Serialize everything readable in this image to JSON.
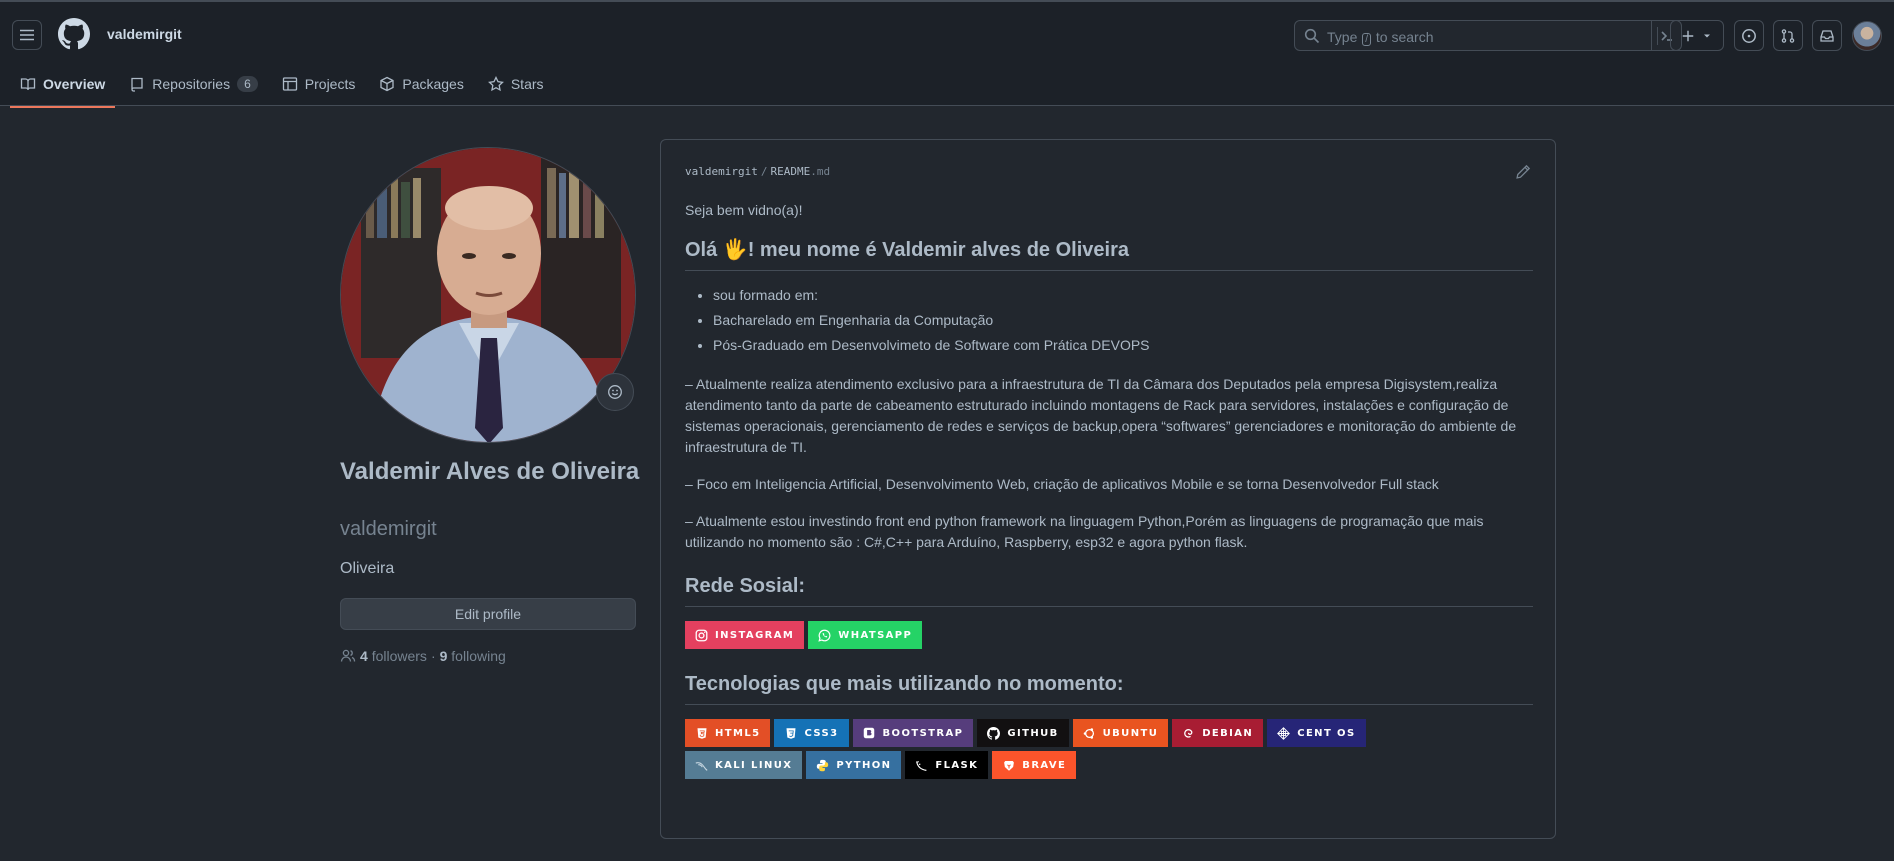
{
  "header": {
    "username": "valdemirgit",
    "search": {
      "placeholder_before": "Type",
      "placeholder_key": "/",
      "placeholder_after": "to search"
    }
  },
  "tabs": [
    {
      "label": "Overview",
      "icon": "book-icon",
      "active": true
    },
    {
      "label": "Repositories",
      "icon": "repo-icon",
      "count": "6"
    },
    {
      "label": "Projects",
      "icon": "table-icon"
    },
    {
      "label": "Packages",
      "icon": "package-icon"
    },
    {
      "label": "Stars",
      "icon": "star-icon"
    }
  ],
  "profile": {
    "name": "Valdemir Alves de Oliveira",
    "login": "valdemirgit",
    "bio": "Oliveira",
    "edit_label": "Edit profile",
    "followers_count": "4",
    "followers_label": "followers",
    "separator": "·",
    "following_count": "9",
    "following_label": "following"
  },
  "readme": {
    "crumb_owner": "valdemirgit",
    "crumb_sep": "/",
    "crumb_file": "README",
    "crumb_ext": ".md",
    "welcome": "Seja bem vidno(a)!",
    "heading1": "Olá 🖐! meu nome é Valdemir alves de Oliveira",
    "list": [
      "sou formado em:",
      "Bacharelado em Engenharia da Computação",
      "Pós-Graduado em Desenvolvimeto de Software com Prática DEVOPS"
    ],
    "para1": "– Atualmente realiza atendimento exclusivo para a infraestrutura de TI da Câmara dos Deputados pela empresa Digisystem,realiza atendimento tanto da parte de cabeamento estruturado incluindo montagens de Rack para servidores, instalações e configuração de sistemas operacionais, gerenciamento de redes e serviços de backup,opera “softwares” gerenciadores e monitoração do ambiente de infraestrutura de TI.",
    "para2": "– Foco em Inteligencia Artificial, Desenvolvimento Web, criação de aplicativos Mobile e se torna Desenvolvedor Full stack",
    "para3": "– Atualmente estou investindo front end python framework na linguagem Python,Porém as linguagens de programação que mais utilizando no momento são : C#,C++ para Arduíno, Raspberry, esp32 e agora python flask.",
    "heading2": "Rede Sosial:",
    "social": [
      {
        "label": "INSTAGRAM",
        "color": "#E4405F",
        "icon": "instagram-icon"
      },
      {
        "label": "WHATSAPP",
        "color": "#25D366",
        "icon": "whatsapp-icon"
      }
    ],
    "heading3": "Tecnologias que mais utilizando no momento:",
    "tech": [
      {
        "label": "HTML5",
        "color": "#E34F26",
        "icon": "html5-icon"
      },
      {
        "label": "CSS3",
        "color": "#1572B6",
        "icon": "css3-icon"
      },
      {
        "label": "BOOTSTRAP",
        "color": "#563D7C",
        "icon": "bootstrap-icon"
      },
      {
        "label": "GITHUB",
        "color": "#121011",
        "icon": "github-icon"
      },
      {
        "label": "UBUNTU",
        "color": "#E95420",
        "icon": "ubuntu-icon"
      },
      {
        "label": "DEBIAN",
        "color": "#A81D33",
        "icon": "debian-icon"
      },
      {
        "label": "CENT OS",
        "color": "#262577",
        "icon": "centos-icon"
      },
      {
        "label": "KALI LINUX",
        "color": "#557C94",
        "icon": "kali-icon"
      },
      {
        "label": "PYTHON",
        "color": "#3670A0",
        "icon": "python-icon"
      },
      {
        "label": "FLASK",
        "color": "#000000",
        "icon": "flask-icon"
      },
      {
        "label": "BRAVE",
        "color": "#FB542B",
        "icon": "brave-icon"
      }
    ]
  }
}
